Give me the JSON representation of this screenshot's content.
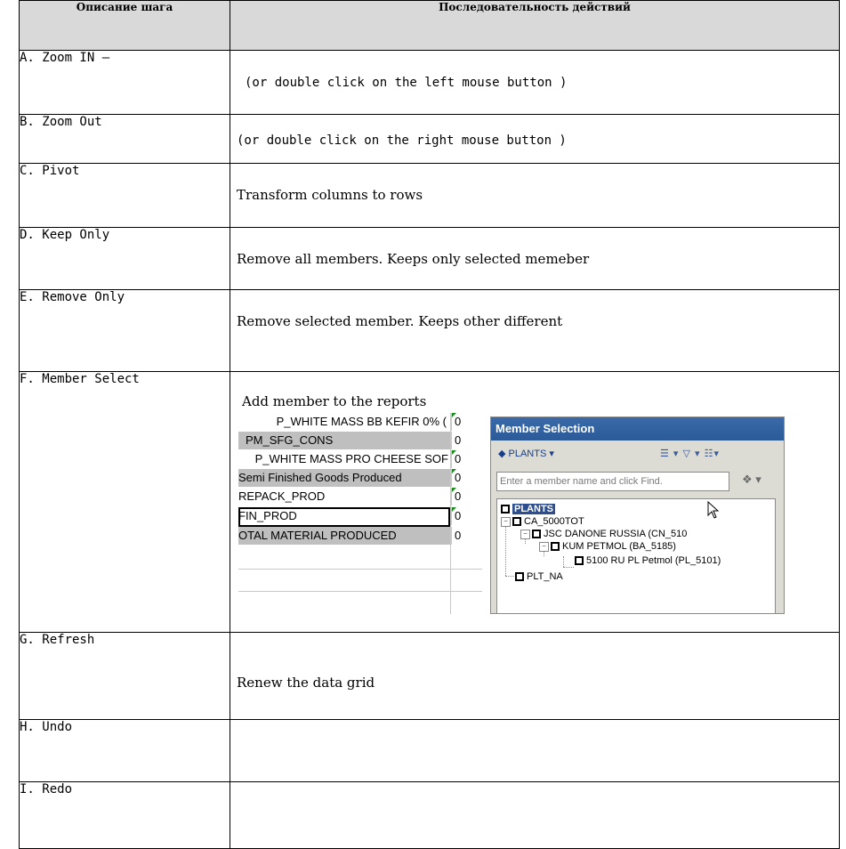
{
  "header": {
    "col1": "Описание шага",
    "col2": "Последовательность действий"
  },
  "steps": [
    {
      "label": "A. Zoom IN –",
      "desc": "(or double click on the left mouse button )"
    },
    {
      "label": "B. Zoom Out",
      "desc": "(or double click on the right mouse button )"
    },
    {
      "label": "C. Pivot",
      "desc": "Transform columns  to rows"
    },
    {
      "label": "D. Keep Only",
      "desc": "Remove all members. Keeps only selected memeber"
    },
    {
      "label": "E. Remove Only",
      "desc": "Remove selected member. Keeps other different"
    },
    {
      "label": "F. Member Select",
      "desc": "Add member to the reports"
    },
    {
      "label": "G. Refresh",
      "desc": "Renew the data grid"
    },
    {
      "label": "H. Undo",
      "desc": ""
    },
    {
      "label": "I. Redo",
      "desc": ""
    }
  ],
  "grid": {
    "rows": [
      {
        "name": "P_WHITE MASS BB KEFIR 0% (",
        "value": "0"
      },
      {
        "name": "PM_SFG_CONS",
        "value": "0"
      },
      {
        "name": "P_WHITE MASS PRO CHEESE SOF",
        "value": "0"
      },
      {
        "name": "Semi Finished Goods Produced",
        "value": "0"
      },
      {
        "name": "REPACK_PROD",
        "value": "0"
      },
      {
        "name": "FIN_PROD",
        "value": "0"
      },
      {
        "name": "OTAL MATERIAL PRODUCED",
        "value": "0"
      }
    ]
  },
  "member_selection": {
    "title": "Member Selection",
    "dimension": "PLANTS",
    "find_placeholder": "Enter a member name and click Find.",
    "tree": [
      {
        "label": "PLANTS",
        "level": 0
      },
      {
        "label": "CA_5000TOT",
        "level": 1
      },
      {
        "label": "JSC DANONE RUSSIA (CN_510",
        "level": 2
      },
      {
        "label": "KUM PETMOL (BA_5185)",
        "level": 3
      },
      {
        "label": "5100 RU PL Petmol (PL_5101)",
        "level": 4
      },
      {
        "label": "PLT_NA",
        "level": 1
      }
    ]
  }
}
